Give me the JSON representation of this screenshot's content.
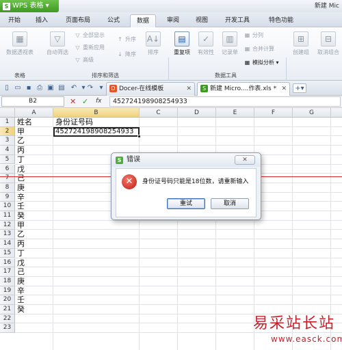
{
  "app": {
    "name": "WPS 表格",
    "window_title": "新建 Mic"
  },
  "tabs": [
    "开始",
    "插入",
    "页面布局",
    "公式",
    "数据",
    "审阅",
    "视图",
    "开发工具",
    "特色功能"
  ],
  "active_tab": "数据",
  "ribbon": {
    "pivot": "数据透视表",
    "autofilter": "自动筛选",
    "show_all": "全部显示",
    "reapply": "重新应用",
    "advanced": "高级",
    "sort_asc": "升序",
    "sort_desc": "降序",
    "sort": "排序",
    "duplicates": "重复项",
    "validity": "有效性",
    "record": "记录单",
    "split": "分列",
    "consolidate": "合并计算",
    "whatif": "模拟分析",
    "create_group": "创建组",
    "ungroup": "取消组合",
    "group_table": "表格",
    "group_sort": "排序和筛选",
    "group_tools": "数据工具"
  },
  "doc_tabs": [
    {
      "label": "Docer-在线模板"
    },
    {
      "label": "新建 Micro....作表.xls *"
    }
  ],
  "formula_bar": {
    "name_box": "B2",
    "fx": "fx",
    "value": "452724198908254933"
  },
  "columns": [
    "A",
    "B",
    "C",
    "D",
    "E",
    "F",
    "G"
  ],
  "rows": [
    "1",
    "2",
    "3",
    "4",
    "5",
    "6",
    "7",
    "8",
    "9",
    "10",
    "11",
    "12",
    "13",
    "14",
    "15",
    "16",
    "17",
    "18",
    "19",
    "20",
    "21",
    "22",
    "23"
  ],
  "column_a": [
    "姓名",
    "甲",
    "乙",
    "丙",
    "丁",
    "戊",
    "己",
    "庚",
    "辛",
    "壬",
    "癸",
    "甲",
    "乙",
    "丙",
    "丁",
    "戊",
    "己",
    "庚",
    "辛",
    "壬",
    "癸"
  ],
  "b1": "身份证号码",
  "b2": "452724198908254933",
  "dialog": {
    "title": "错误",
    "close": "✕",
    "message": "身份证号码只能是18位数，请重新输入",
    "ok": "重试",
    "cancel": "取消"
  },
  "watermark": {
    "line1": "易采站长站",
    "line2": "www.easck.com"
  },
  "colors": {
    "accent_green": "#4caf3a",
    "error_red": "#c01a12",
    "selection_header": "#f1d27c"
  }
}
